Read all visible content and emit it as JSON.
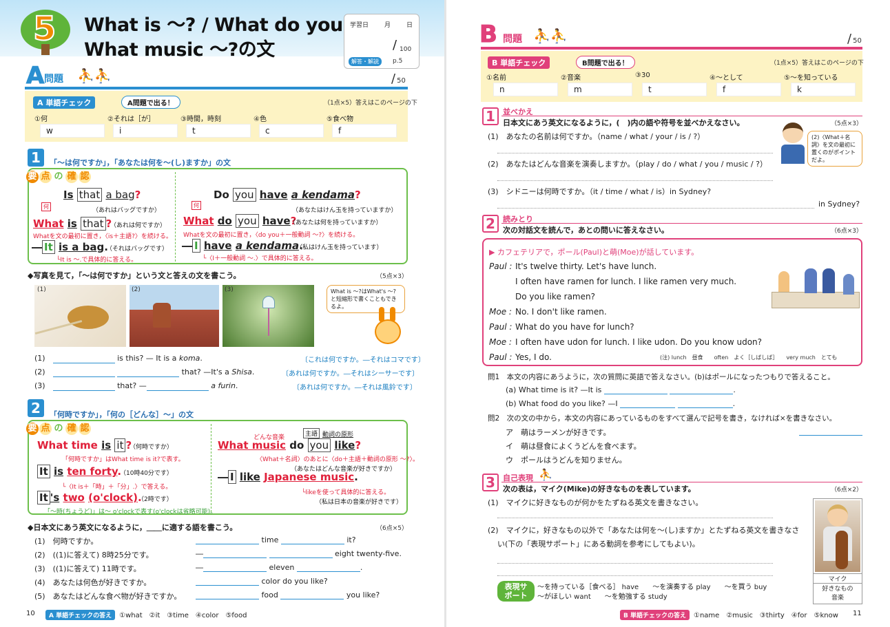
{
  "left": {
    "unit_number": "5",
    "title_line1": "What is ～? / What do you ～? /",
    "title_line2": "What music ～?の文",
    "study_date_label": "学習日",
    "month": "月",
    "day": "日",
    "score_total": "100",
    "answer_ref_label": "解答・解説",
    "answer_ref_page": "p.5",
    "section_A": "A",
    "section_A_label": "問題",
    "section_A_score": "50",
    "tango_check_badge": "A 単語チェック",
    "tango_bubble": "A問題で出る！",
    "tango_points": "（1点×5）答えはこのページの下",
    "vocab": [
      {
        "label": "①何",
        "hint": "w"
      },
      {
        "label": "②それは［が］",
        "hint": "i"
      },
      {
        "label": "③時間，時刻",
        "hint": "t"
      },
      {
        "label": "④色",
        "hint": "c"
      },
      {
        "label": "⑤食べ物",
        "hint": "f"
      }
    ],
    "sec1_num": "1",
    "sec1_title": "「～は何ですか」，「あなたは何を～(し)ますか」の文",
    "youten": [
      "要",
      "点",
      "の",
      "確",
      "認"
    ],
    "ex1": {
      "s1": "Is",
      "s1b": "that",
      "s1c": "a bag",
      "s1q": "?",
      "s1_jp": "（あれはバッグですか）",
      "what_tag": "何",
      "s2a": "What",
      "s2b": "is",
      "s2c": "that",
      "s2q": "?",
      "s2_jp": "（あれは何ですか）",
      "s2_note": "Whatを文の最初に置き，〈is＋主語?〉を続ける。",
      "s3dash": "―",
      "s3a": "It",
      "s3b": "is a bag",
      "s3q": ".",
      "s3_jp": "（それはバッグです）",
      "s3_note": "└It is ～.で具体的に答える。"
    },
    "ex2": {
      "s1": "Do",
      "s1b": "you",
      "s1c": "have",
      "s1d": "a kendama",
      "s1q": "?",
      "s1_jp": "（あなたはけん玉を持っていますか）",
      "what_tag": "何",
      "s2a": "What",
      "s2b": "do",
      "s2c": "you",
      "s2d": "have",
      "s2q": "?",
      "s2_jp": "（あなたは何を持っていますか）",
      "s2_note": "Whatを文の最初に置き，〈do you＋一般動詞 ～?〉を続ける。",
      "s3dash": "―",
      "s3a": "I",
      "s3b": "have",
      "s3c": "a kendama",
      "s3q": ".",
      "s3_jp": "（私はけん玉を持っています）",
      "s3_note": "└〈I＋一般動詞 ～.〉で具体的に答える。"
    },
    "photo_q": "◆写真を見て，「～は何ですか」という文と答えの文を書こう。",
    "photo_q_points": "（5点×3）",
    "photo_labels": [
      "(1)",
      "(2)",
      "(3)"
    ],
    "tip_bubble": "What is ～?はWhat's ～?と短縮形で書くこともできるよ。",
    "pq": [
      {
        "num": "(1)",
        "a": "is this? — It is a",
        "b": "koma",
        "c": ".",
        "hint": "〔これは何ですか。―それはコマです〕"
      },
      {
        "num": "(2)",
        "a": "that? —It's a",
        "b": "Shisa",
        "c": ".",
        "hint": "〔あれは何ですか。―それはシーサーです〕"
      },
      {
        "num": "(3)",
        "a": "that? —",
        "b": "a furin",
        "c": ".",
        "hint": "〔あれは何ですか。―それは風鈴です〕"
      }
    ],
    "sec2_num": "2",
    "sec2_title": "「何時ですか」，「何の［どんな］～」の文",
    "ex3": {
      "s1a": "What time",
      "s1b": "is",
      "s1c": "it",
      "s1q": "?",
      "s1_jp": "（何時ですか）",
      "s1_note": "「何時ですか」はWhat time is it?で表す。",
      "s2a": "It",
      "s2b": "is",
      "s2c": "ten forty",
      "s2q": ".",
      "s2_jp": "（10時40分です）",
      "s2_note": "└〈It is＋「時」＋「分」.〉で答える。",
      "s3a": "It",
      "s3b": "'s",
      "s3c": "two",
      "s3d": "(o'clock)",
      "s3q": ".",
      "s3_jp": "（2時です）",
      "s3_note": "「～時(ちょうど)」は～ o'clockで表す(o'clockは省略可能)。"
    },
    "ex4": {
      "tag1": "どんな音楽",
      "tag2": "主語",
      "tag3": "動詞の原形",
      "s1a": "What music",
      "s1b": "do",
      "s1c": "you",
      "s1d": "like",
      "s1q": "?",
      "s1_note": "〈What＋名詞〉のあとに〈do＋主語＋動詞の原形 ～?〉。",
      "s1_jp": "（あなたはどんな音楽が好きですか）",
      "s2dash": "―",
      "s2a": "I",
      "s2b": "like",
      "s2c": "Japanese music",
      "s2q": ".",
      "s2_note": "└likeを使って具体的に答える。",
      "s2_jp": "（私は日本の音楽が好きです）"
    },
    "jq": "◆日本文にあう英文になるように，＿＿に適する語を書こう。",
    "jq_points": "（6点×5）",
    "jqs": [
      {
        "num": "(1)",
        "jp": "何時ですか。",
        "pre": "",
        "mid": "time",
        "post": "it?"
      },
      {
        "num": "(2)",
        "jp": "((1)に答えて) 8時25分です。",
        "pre": "―",
        "mid": "",
        "post": "eight twenty-five."
      },
      {
        "num": "(3)",
        "jp": "((1)に答えて) 11時です。",
        "pre": "―",
        "mid": "eleven",
        "post": "."
      },
      {
        "num": "(4)",
        "jp": "あなたは何色が好きですか。",
        "pre": "",
        "mid": "color do you like?",
        "post": ""
      },
      {
        "num": "(5)",
        "jp": "あなたはどんな食べ物が好きですか。",
        "pre": "",
        "mid": "food",
        "post": "you like?"
      }
    ],
    "page_num": "10",
    "footer_badge": "A 単語チェックの答え",
    "footer_answers": "①what　②it　③time　④color　⑤food"
  },
  "right": {
    "section_B": "B",
    "section_B_label": "問題",
    "section_B_score": "50",
    "tango_check_badge": "B 単語チェック",
    "tango_bubble": "B問題で出る！",
    "tango_points": "（1点×5）答えはこのページの下",
    "vocab": [
      {
        "label": "①名前",
        "hint": "n"
      },
      {
        "label": "②音楽",
        "hint": "m"
      },
      {
        "label": "③30",
        "hint": "t"
      },
      {
        "label": "④～として",
        "hint": "f"
      },
      {
        "label": "⑤～を知っている",
        "hint": "k"
      }
    ],
    "s1_num": "1",
    "s1_title": "並べかえ",
    "s1_q": "日本文にあう英文になるように，(　)内の語や符号を並べかえなさい。",
    "s1_points": "（5点×3）",
    "s1_items": [
      {
        "num": "(1)",
        "text": "あなたの名前は何ですか。（name / what / your / is / ?）"
      },
      {
        "num": "(2)",
        "text": "あなたはどんな音楽を演奏しますか。（play / do / what / you / music / ?）"
      },
      {
        "num": "(3)",
        "text": "シドニーは何時ですか。（it / time / what / is）in Sydney?"
      }
    ],
    "s1_tail": "in Sydney?",
    "s1_tip": "(2)〈What＋名詞〉を文の最初に置くのがポイントだよ。",
    "s2_num": "2",
    "s2_title": "読みとり",
    "s2_q": "次の対話文を読んで，あとの問いに答えなさい。",
    "s2_points": "（6点×3）",
    "scene": "▶ カフェテリアで，ポール(Paul)と萌(Moe)が話しています。",
    "dialog": [
      {
        "sp": "Paul :",
        "text": "It's twelve thirty.  Let's have lunch."
      },
      {
        "sp": "",
        "text": "I often have ramen for lunch.  I like ramen very much."
      },
      {
        "sp": "",
        "text": "Do you like ramen?"
      },
      {
        "sp": "Moe :",
        "text": "No.  I don't like ramen."
      },
      {
        "sp": "Paul :",
        "text": "What do you have for lunch?"
      },
      {
        "sp": "Moe :",
        "text": "I often have udon for lunch.  I like udon.  Do you know udon?"
      },
      {
        "sp": "Paul :",
        "text": "Yes, I do."
      }
    ],
    "gloss": "(注) lunch　昼食　　often　よく［しばしば］　　very much　とても",
    "mon1": "問1　本文の内容にあうように，次の質問に英語で答えなさい。(b)はポールになったつもりで答えること。",
    "mon1a": "(a)  What time is it? —It is",
    "mon1b": "(b)  What food do you like? —I",
    "mon2": "問2　次の文の中から，本文の内容にあっているものをすべて選んで記号を書き，なければ×を書きなさい。",
    "choices": [
      {
        "k": "ア",
        "t": "萌はラーメンが好きです。"
      },
      {
        "k": "イ",
        "t": "萌は昼食によくうどんを食べます。"
      },
      {
        "k": "ウ",
        "t": "ポールはうどんを知りません。"
      }
    ],
    "s3_num": "3",
    "s3_title": "自己表現",
    "s3_q": "次の表は，マイク(Mike)の好きなものを表しています。",
    "s3_points": "（6点×2）",
    "s3_items": [
      {
        "num": "(1)",
        "text": "マイクに好きなものが何かをたずねる英文を書きなさい。"
      },
      {
        "num": "(2)",
        "text": "マイクに，好きなもの以外で「あなたは何を～(し)ますか」とたずねる英文を書きなさ"
      }
    ],
    "s3_item2b": "い(下の「表現サポート」にある動詞を参考にしてもよい)。",
    "mike_name": "マイク",
    "mike_like": "好きなもの",
    "mike_value": "音楽",
    "hyogen": "表現サポート",
    "support1": "～を持っている［食べる］ have　　～を演奏する play　　～を買う buy",
    "support2": "～がほしい want　　～を勉強する study",
    "footer_badge": "B 単語チェックの答え",
    "footer_answers": "①name　②music　③thirty　④for　⑤know",
    "page_num": "11"
  }
}
